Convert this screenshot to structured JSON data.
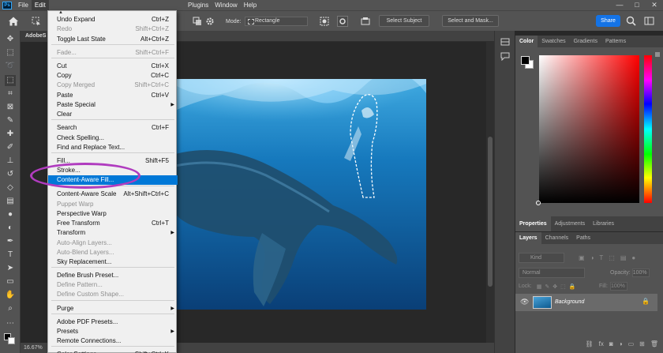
{
  "menubar": {
    "left_items": [
      "File",
      "Edit"
    ],
    "right_items": [
      "Plugins",
      "Window",
      "Help"
    ],
    "window_controls": [
      "—",
      "□",
      "✕"
    ]
  },
  "options": {
    "mode_label": "Mode:",
    "mode_value": "Rectangle",
    "select_subject": "Select Subject",
    "select_mask": "Select and Mask...",
    "share": "Share"
  },
  "document": {
    "tab_name": "AdobeS",
    "zoom": "16.67%"
  },
  "edit_menu": {
    "items": [
      {
        "label": "Undo Expand",
        "shortcut": "Ctrl+Z",
        "disabled": false
      },
      {
        "label": "Redo",
        "shortcut": "Shift+Ctrl+Z",
        "disabled": true
      },
      {
        "label": "Toggle Last State",
        "shortcut": "Alt+Ctrl+Z",
        "disabled": false
      },
      {
        "label": "Fade...",
        "shortcut": "Shift+Ctrl+F",
        "disabled": true
      },
      {
        "label": "Cut",
        "shortcut": "Ctrl+X",
        "disabled": false
      },
      {
        "label": "Copy",
        "shortcut": "Ctrl+C",
        "disabled": false
      },
      {
        "label": "Copy Merged",
        "shortcut": "Shift+Ctrl+C",
        "disabled": true
      },
      {
        "label": "Paste",
        "shortcut": "Ctrl+V",
        "disabled": false
      },
      {
        "label": "Paste Special",
        "shortcut": "",
        "disabled": false,
        "submenu": true
      },
      {
        "label": "Clear",
        "shortcut": "",
        "disabled": false
      },
      {
        "label": "Search",
        "shortcut": "Ctrl+F",
        "disabled": false
      },
      {
        "label": "Check Spelling...",
        "shortcut": "",
        "disabled": false
      },
      {
        "label": "Find and Replace Text...",
        "shortcut": "",
        "disabled": false
      },
      {
        "label": "Fill...",
        "shortcut": "Shift+F5",
        "disabled": false
      },
      {
        "label": "Stroke...",
        "shortcut": "",
        "disabled": false
      },
      {
        "label": "Content-Aware Fill...",
        "shortcut": "",
        "disabled": false,
        "highlighted": true
      },
      {
        "label": "Content-Aware Scale",
        "shortcut": "Alt+Shift+Ctrl+C",
        "disabled": false
      },
      {
        "label": "Puppet Warp",
        "shortcut": "",
        "disabled": true
      },
      {
        "label": "Perspective Warp",
        "shortcut": "",
        "disabled": false
      },
      {
        "label": "Free Transform",
        "shortcut": "Ctrl+T",
        "disabled": false
      },
      {
        "label": "Transform",
        "shortcut": "",
        "disabled": false,
        "submenu": true
      },
      {
        "label": "Auto-Align Layers...",
        "shortcut": "",
        "disabled": true
      },
      {
        "label": "Auto-Blend Layers...",
        "shortcut": "",
        "disabled": true
      },
      {
        "label": "Sky Replacement...",
        "shortcut": "",
        "disabled": false
      },
      {
        "label": "Define Brush Preset...",
        "shortcut": "",
        "disabled": false
      },
      {
        "label": "Define Pattern...",
        "shortcut": "",
        "disabled": true
      },
      {
        "label": "Define Custom Shape...",
        "shortcut": "",
        "disabled": true
      },
      {
        "label": "Purge",
        "shortcut": "",
        "disabled": false,
        "submenu": true
      },
      {
        "label": "Adobe PDF Presets...",
        "shortcut": "",
        "disabled": false
      },
      {
        "label": "Presets",
        "shortcut": "",
        "disabled": false,
        "submenu": true
      },
      {
        "label": "Remote Connections...",
        "shortcut": "",
        "disabled": false
      },
      {
        "label": "Color Settings...",
        "shortcut": "Shift+Ctrl+K",
        "disabled": false
      }
    ]
  },
  "color_panel": {
    "tabs": [
      "Color",
      "Swatches",
      "Gradients",
      "Patterns"
    ],
    "active_tab": "Color",
    "foreground": "#000000",
    "background": "#ffffff"
  },
  "props_panel": {
    "tabs": [
      "Properties",
      "Adjustments",
      "Libraries"
    ]
  },
  "layers_panel": {
    "tabs": [
      "Layers",
      "Channels",
      "Paths"
    ],
    "kind_label": "Kind",
    "blend_mode": "Normal",
    "opacity_label": "Opacity:",
    "opacity_value": "100%",
    "lock_label": "Lock:",
    "fill_label": "Fill:",
    "fill_value": "100%",
    "layer_name": "Background",
    "bottom_icons": [
      "link-icon",
      "fx-icon",
      "mask-icon",
      "adjustment-icon",
      "folder-icon",
      "new-layer-icon",
      "trash-icon"
    ]
  },
  "accent_colors": {
    "highlight": "#0078d7",
    "annotation": "#b03cbf",
    "share": "#1473e6"
  }
}
